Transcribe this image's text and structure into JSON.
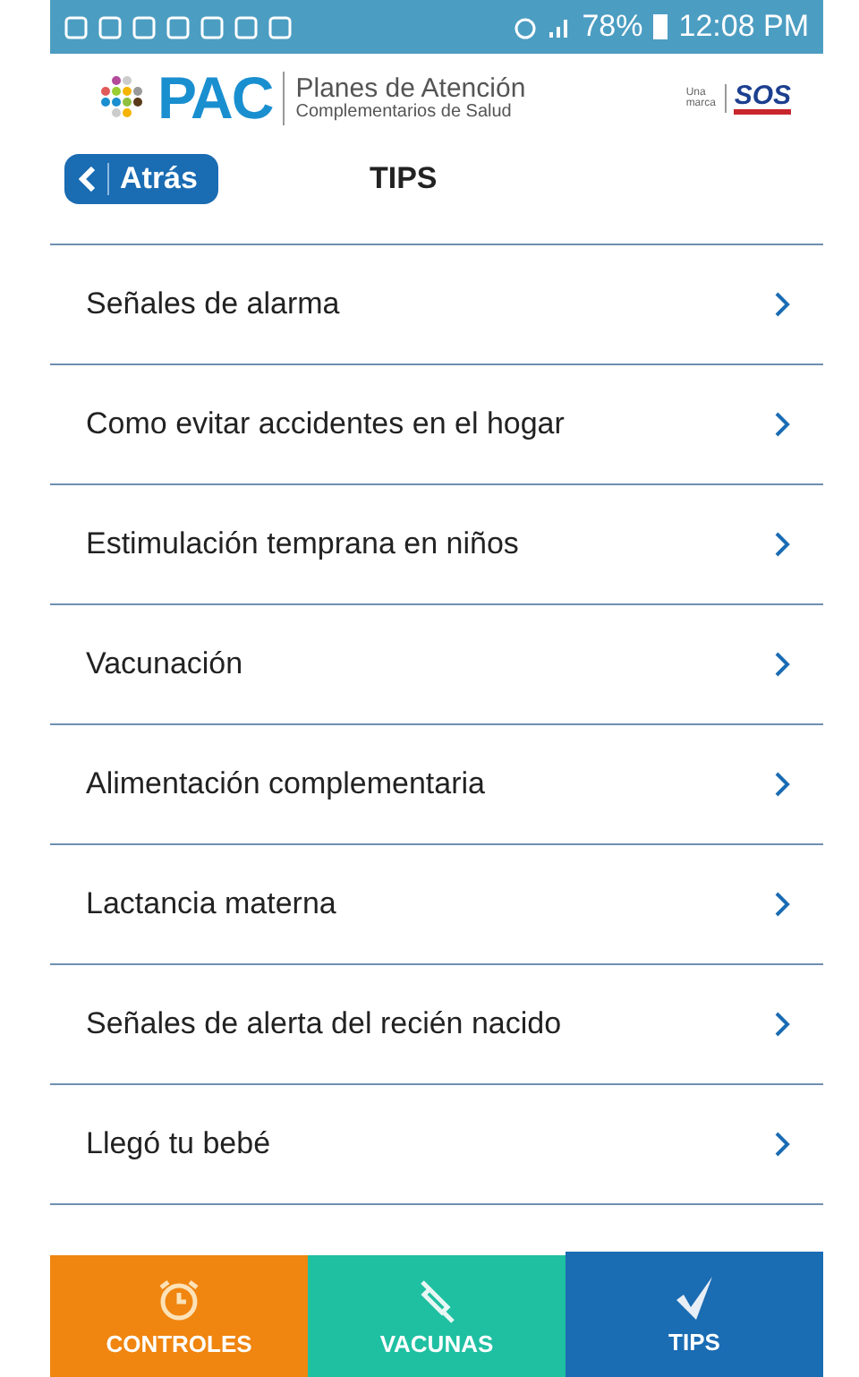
{
  "status_bar": {
    "battery": "78%",
    "time": "12:08 PM"
  },
  "header": {
    "logo": "PAC",
    "tagline_1": "Planes de Atención",
    "tagline_2": "Complementarios de Salud",
    "brand_prefix": "Una marca",
    "brand": "SOS"
  },
  "nav": {
    "back": "Atrás",
    "title": "TIPS"
  },
  "items": [
    {
      "label": "Señales de alarma"
    },
    {
      "label": "Como evitar accidentes en el hogar"
    },
    {
      "label": "Estimulación temprana en niños"
    },
    {
      "label": "Vacunación"
    },
    {
      "label": "Alimentación complementaria"
    },
    {
      "label": "Lactancia materna"
    },
    {
      "label": "Señales de alerta del recién nacido"
    },
    {
      "label": "Llegó tu bebé"
    }
  ],
  "tabs": [
    {
      "label": "CONTROLES",
      "kind": "alarm",
      "selected": false
    },
    {
      "label": "VACUNAS",
      "kind": "syringe",
      "selected": false
    },
    {
      "label": "TIPS",
      "kind": "check",
      "selected": true
    }
  ]
}
